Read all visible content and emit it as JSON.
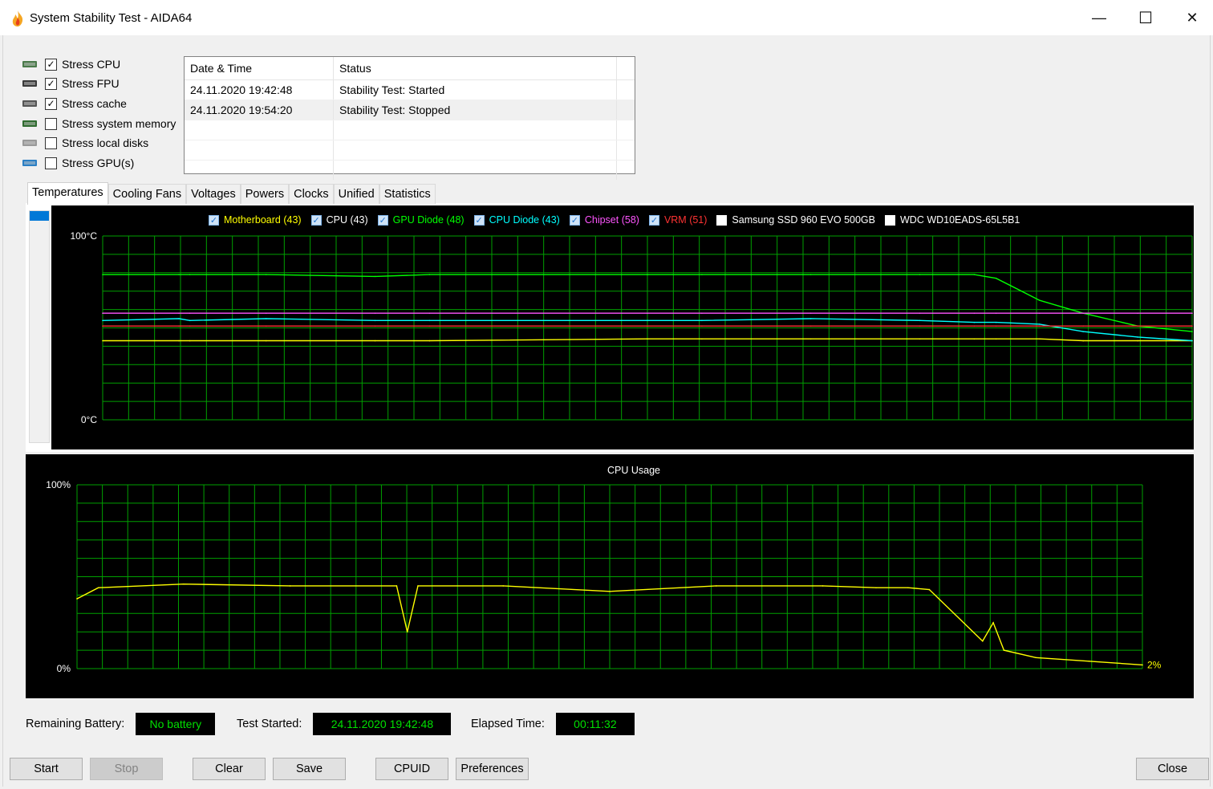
{
  "window": {
    "title": "System Stability Test - AIDA64",
    "minimize": "—",
    "maximize": "☐",
    "close": "✕"
  },
  "stress_options": [
    {
      "label": "Stress CPU",
      "checked": true,
      "icon": "cpu-icon"
    },
    {
      "label": "Stress FPU",
      "checked": true,
      "icon": "fpu-icon"
    },
    {
      "label": "Stress cache",
      "checked": true,
      "icon": "cache-icon"
    },
    {
      "label": "Stress system memory",
      "checked": false,
      "icon": "memory-icon"
    },
    {
      "label": "Stress local disks",
      "checked": false,
      "icon": "disk-icon"
    },
    {
      "label": "Stress GPU(s)",
      "checked": false,
      "icon": "gpu-icon"
    }
  ],
  "log": {
    "headers": [
      "Date & Time",
      "Status"
    ],
    "rows": [
      [
        "24.11.2020 19:42:48",
        "Stability Test: Started"
      ],
      [
        "24.11.2020 19:54:20",
        "Stability Test: Stopped"
      ]
    ]
  },
  "tabs": [
    "Temperatures",
    "Cooling Fans",
    "Voltages",
    "Powers",
    "Clocks",
    "Unified",
    "Statistics"
  ],
  "colors": {
    "grid": "#00a000",
    "motherboard": "#ffff00",
    "cpu": "#ffffff",
    "gpu_diode": "#00ff00",
    "cpu_diode": "#00ffff",
    "chipset": "#ff55ff",
    "vrm": "#ff3333",
    "cpu_usage": "#ffff00"
  },
  "legend": [
    {
      "label": "Motherboard (43)",
      "checked": true,
      "color": "#ffff00"
    },
    {
      "label": "CPU (43)",
      "checked": true,
      "color": "#ffffff"
    },
    {
      "label": "GPU Diode (48)",
      "checked": true,
      "color": "#00ff00"
    },
    {
      "label": "CPU Diode (43)",
      "checked": true,
      "color": "#00ffff"
    },
    {
      "label": "Chipset (58)",
      "checked": true,
      "color": "#ff55ff"
    },
    {
      "label": "VRM (51)",
      "checked": true,
      "color": "#ff3333"
    },
    {
      "label": "Samsung SSD 960 EVO 500GB",
      "checked": false,
      "color": "#ffffff"
    },
    {
      "label": "WDC WD10EADS-65L5B1",
      "checked": false,
      "color": "#ffffff"
    }
  ],
  "chart_data": [
    {
      "type": "line",
      "title": "",
      "ylim": [
        0,
        100
      ],
      "y_top_label": "100°C",
      "y_bottom_label": "0°C",
      "x": [
        0,
        7,
        8,
        15,
        25,
        30,
        50,
        55,
        65,
        75,
        80,
        82,
        86,
        90,
        95,
        100
      ],
      "series": [
        {
          "name": "Motherboard",
          "values": [
            43,
            43,
            43,
            43,
            43,
            43,
            44,
            44,
            44,
            44,
            44,
            44,
            44,
            43,
            43,
            43
          ],
          "end_label": "43"
        },
        {
          "name": "GPU Diode",
          "values": [
            79,
            79,
            79,
            79,
            78,
            79,
            79,
            79,
            79,
            79,
            79,
            77,
            65,
            58,
            51,
            48
          ],
          "end_label": "48"
        },
        {
          "name": "CPU Diode",
          "values": [
            54,
            55,
            54,
            55,
            54,
            54,
            54,
            54,
            55,
            54,
            53,
            53,
            52,
            48,
            45,
            43
          ],
          "end_label": "43"
        },
        {
          "name": "Chipset",
          "values": [
            58,
            58,
            58,
            58,
            58,
            58,
            58,
            58,
            58,
            58,
            58,
            58,
            58,
            58,
            58,
            58
          ],
          "end_label": "58"
        },
        {
          "name": "VRM",
          "values": [
            51,
            51,
            51,
            51,
            51,
            51,
            51,
            51,
            51,
            51,
            51,
            51,
            51,
            51,
            51,
            51
          ],
          "end_label": "51"
        }
      ]
    },
    {
      "type": "line",
      "title": "CPU Usage",
      "ylim": [
        0,
        100
      ],
      "y_top_label": "100%",
      "y_bottom_label": "0%",
      "x": [
        0,
        2,
        10,
        20,
        30,
        31,
        32,
        40,
        50,
        60,
        70,
        75,
        78,
        80,
        85,
        86,
        87,
        90,
        95,
        100
      ],
      "series": [
        {
          "name": "CPU Usage",
          "values": [
            38,
            44,
            46,
            45,
            45,
            20,
            45,
            45,
            42,
            45,
            45,
            44,
            44,
            43,
            15,
            25,
            10,
            6,
            4,
            2
          ],
          "end_label": "2%"
        }
      ]
    }
  ],
  "status": {
    "battery_label": "Remaining Battery:",
    "battery_value": "No battery",
    "started_label": "Test Started:",
    "started_value": "24.11.2020 19:42:48",
    "elapsed_label": "Elapsed Time:",
    "elapsed_value": "00:11:32"
  },
  "buttons": {
    "start": "Start",
    "stop": "Stop",
    "clear": "Clear",
    "save": "Save",
    "cpuid": "CPUID",
    "preferences": "Preferences",
    "close": "Close"
  }
}
